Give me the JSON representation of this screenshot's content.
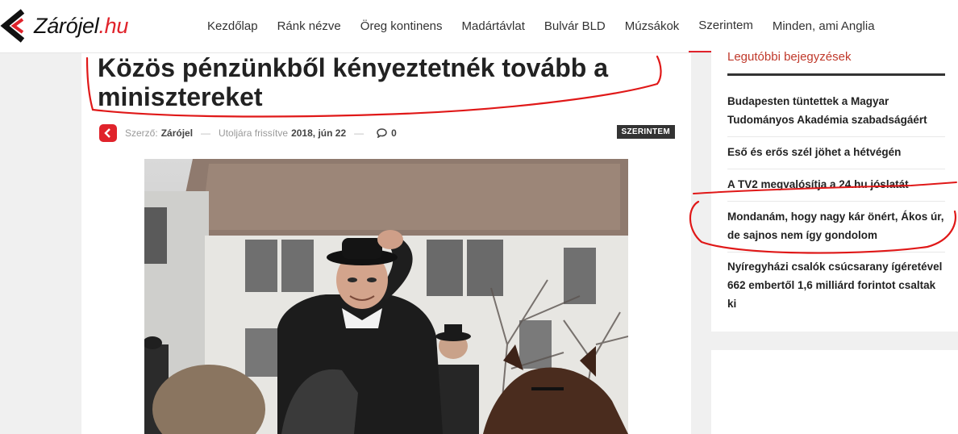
{
  "header": {
    "logo": {
      "name": "Zárójel",
      "tld": ".hu"
    },
    "nav": [
      {
        "label": "Kezdőlap"
      },
      {
        "label": "Ránk nézve"
      },
      {
        "label": "Öreg kontinens"
      },
      {
        "label": "Madártávlat"
      },
      {
        "label": "Bulvár BLD"
      },
      {
        "label": "Múzsákok"
      },
      {
        "label": "Szerintem"
      },
      {
        "label": "Minden, ami Anglia"
      }
    ],
    "active_nav": "Szerintem"
  },
  "article": {
    "title": "Közös pénzünkből kényeztetnék tovább a minisztereket",
    "meta": {
      "author_prefix": "Szerző:",
      "author": "Zárójel",
      "updated_prefix": "Utoljára frissítve",
      "date": "2018, jún 22",
      "comments": "0"
    },
    "category_badge": "SZERINTEM"
  },
  "sidebar": {
    "heading": "Legutóbbi bejegyzések",
    "posts": [
      {
        "title": "Budapesten tüntettek a Magyar Tudományos Akadémia szabadságáért"
      },
      {
        "title": "Eső és erős szél jöhet a hétvégén"
      },
      {
        "title": "A TV2 megvalósítja a 24.hu jóslatát"
      },
      {
        "title": "Mondanám, hogy nagy kár önért, Ákos úr, de sajnos nem így gondolom"
      },
      {
        "title": "Nyíregyházi csalók csúcsarany ígéretével 662 embertől 1,6 milliárd forintot csaltak ki"
      }
    ]
  },
  "colors": {
    "accent": "#e0232b",
    "annotation": "#e01818",
    "text": "#222222"
  },
  "icons": {
    "logo": "chevron-left-icon",
    "comments": "comment-icon"
  }
}
